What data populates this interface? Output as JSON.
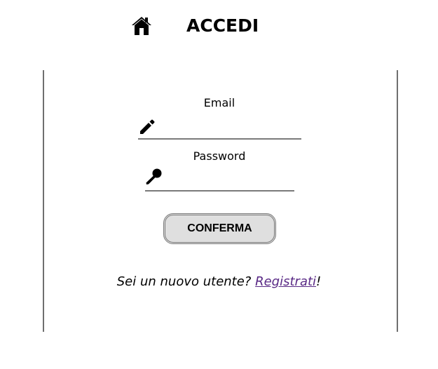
{
  "header": {
    "title": "ACCEDI",
    "home_icon": "home-icon"
  },
  "form": {
    "email": {
      "label": "Email",
      "value": "",
      "icon": "pencil-icon"
    },
    "password": {
      "label": "Password",
      "value": "",
      "icon": "key-icon"
    },
    "confirm_label": "CONFERMA"
  },
  "register": {
    "prompt": "Sei un nuovo utente? ",
    "link_label": "Registrati",
    "suffix": "!"
  },
  "colors": {
    "link": "#5a2a86",
    "button_bg": "#dfdfdf",
    "border": "#6f6f6f"
  }
}
